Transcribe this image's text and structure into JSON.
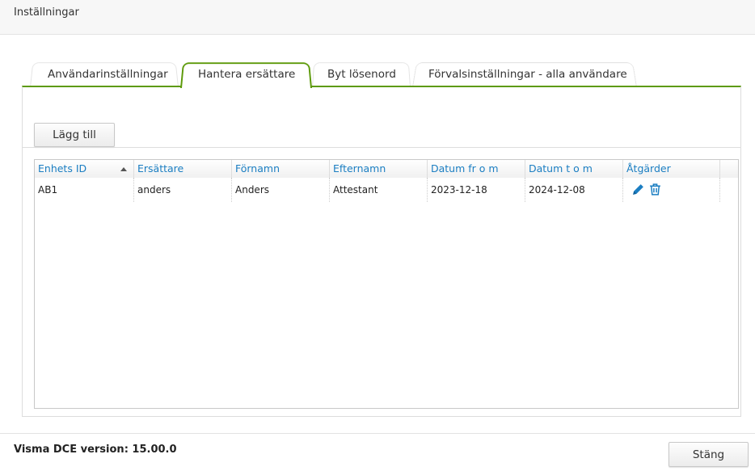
{
  "header": {
    "title": "Inställningar"
  },
  "tabs": [
    {
      "label": "Användarinställningar",
      "active": false
    },
    {
      "label": "Hantera ersättare",
      "active": true
    },
    {
      "label": "Byt lösenord",
      "active": false
    },
    {
      "label": "Förvalsinställningar - alla användare",
      "active": false
    }
  ],
  "toolbar": {
    "add_label": "Lägg till"
  },
  "table": {
    "columns": [
      "Enhets ID",
      "Ersättare",
      "Förnamn",
      "Efternamn",
      "Datum fr o m",
      "Datum t o m",
      "Åtgärder"
    ],
    "sorted_column": "Enhets ID",
    "sort_direction": "ascending",
    "rows": [
      {
        "enhets_id": "AB1",
        "ersattare": "anders",
        "fornamn": "Anders",
        "efternamn": "Attestant",
        "from": "2023-12-18",
        "tom": "2024-12-08",
        "actions": [
          "edit-icon",
          "trash-icon"
        ]
      }
    ]
  },
  "footer": {
    "version": "Visma DCE version: 15.00.0",
    "close_label": "Stäng"
  },
  "colors": {
    "accent": "#5d9a0a",
    "link": "#1b7ec2"
  }
}
